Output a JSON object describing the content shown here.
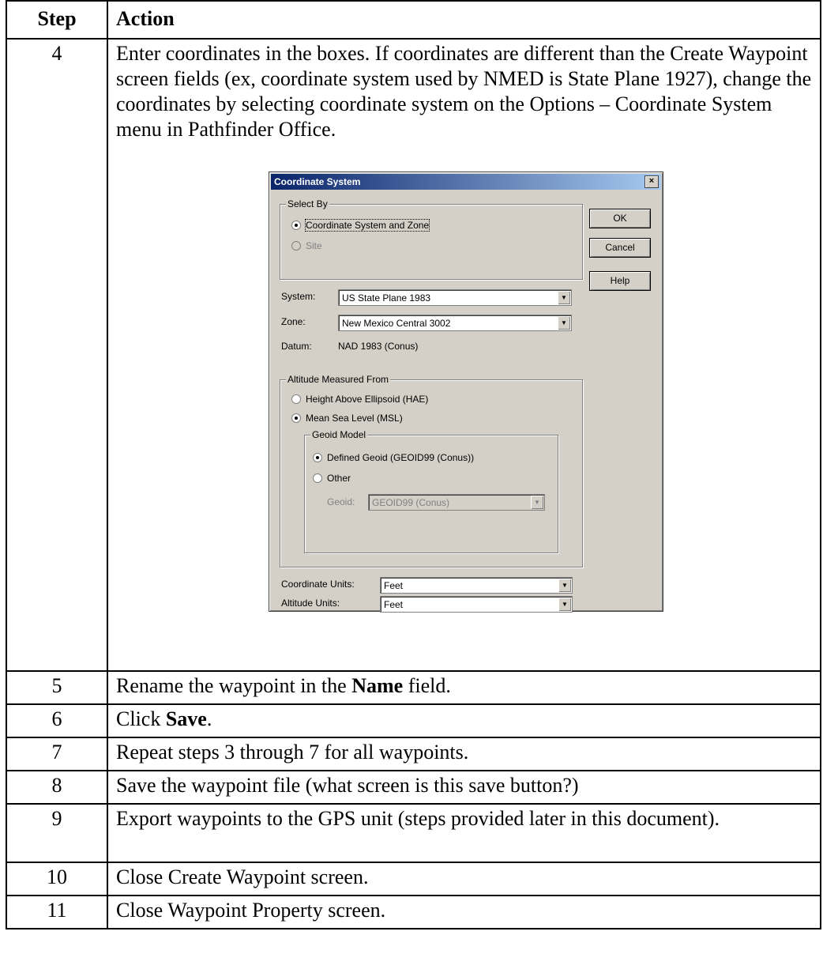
{
  "table": {
    "headers": {
      "step": "Step",
      "action": "Action"
    },
    "rows": [
      {
        "step": "4",
        "text": "Enter coordinates in the boxes.  If coordinates are different than the Create Waypoint screen fields (ex, coordinate system used by NMED is State Plane 1927), change the coordinates by selecting coordinate system on the Options – Coordinate System menu in Pathfinder Office."
      },
      {
        "step": "5",
        "pre": "Rename the waypoint in the ",
        "bold": "Name",
        "post": " field."
      },
      {
        "step": "6",
        "pre": "Click ",
        "bold": "Save",
        "post": "."
      },
      {
        "step": "7",
        "text": "Repeat steps 3 through 7 for all waypoints."
      },
      {
        "step": "8",
        "text": "Save the waypoint file (what screen is this save button?)"
      },
      {
        "step": "9",
        "text": "Export waypoints to the GPS unit (steps provided later in this document)."
      },
      {
        "step": "10",
        "text": "Close Create Waypoint screen."
      },
      {
        "step": "11",
        "text": "Close Waypoint Property screen."
      }
    ]
  },
  "dialog": {
    "title": "Coordinate System",
    "close_glyph": "×",
    "select_by": {
      "label": "Select By",
      "option1": "Coordinate System and Zone",
      "option2": "Site",
      "selected": "option1"
    },
    "buttons": {
      "ok": "OK",
      "cancel": "Cancel",
      "help": "Help"
    },
    "system": {
      "label": "System:",
      "value": "US State Plane 1983"
    },
    "zone": {
      "label": "Zone:",
      "value": "New Mexico Central 3002"
    },
    "datum": {
      "label": "Datum:",
      "value": "NAD 1983 (Conus)"
    },
    "altitude": {
      "label": "Altitude Measured From",
      "option1": "Height Above Ellipsoid (HAE)",
      "option2": "Mean Sea Level (MSL)",
      "selected": "option2"
    },
    "geoid": {
      "label": "Geoid Model",
      "option1": "Defined Geoid (GEOID99 (Conus))",
      "option2": "Other",
      "selected": "option1",
      "field_label": "Geoid:",
      "field_value": "GEOID99 (Conus)"
    },
    "coordinate_units": {
      "label": "Coordinate Units:",
      "value": "Feet"
    },
    "altitude_units": {
      "label": "Altitude Units:",
      "value": "Feet"
    },
    "dropdown_glyph": "▼"
  }
}
